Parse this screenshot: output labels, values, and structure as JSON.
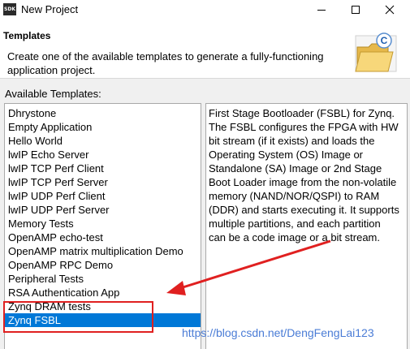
{
  "window": {
    "title": "New Project",
    "app_icon_text": "SDK",
    "controls": {
      "minimize_icon": "minimize-icon",
      "maximize_icon": "maximize-icon",
      "close_icon": "close-icon"
    }
  },
  "header": {
    "title": "Templates",
    "description": "Create one of the available templates to generate a fully-functioning application project.",
    "icon": "new-project-folder-icon"
  },
  "templates": {
    "label": "Available Templates:",
    "items": [
      "Dhrystone",
      "Empty Application",
      "Hello World",
      "lwIP Echo Server",
      "lwIP TCP Perf Client",
      "lwIP TCP Perf Server",
      "lwIP UDP Perf Client",
      "lwIP UDP Perf Server",
      "Memory Tests",
      "OpenAMP echo-test",
      "OpenAMP matrix multiplication Demo",
      "OpenAMP RPC Demo",
      "Peripheral Tests",
      "RSA Authentication App",
      "Zynq DRAM tests",
      "Zynq FSBL"
    ],
    "selected": "Zynq FSBL"
  },
  "description_panel": {
    "text": "First Stage Bootloader (FSBL) for Zynq. The FSBL configures the FPGA with HW bit stream (if it exists)  and loads the Operating System (OS) Image or Standalone (SA) Image or 2nd Stage Boot Loader image from the  non-volatile memory (NAND/NOR/QSPI) to RAM (DDR) and starts executing it.  It supports multiple partitions,  and each partition can be a code image or a bit stream."
  },
  "annotation": {
    "watermark": "https://blog.csdn.net/DengFengLai123",
    "highlight_color": "#e02020"
  },
  "colors": {
    "selection": "#0078d7",
    "accent_red": "#e02020",
    "watermark": "#4a7cd6"
  }
}
